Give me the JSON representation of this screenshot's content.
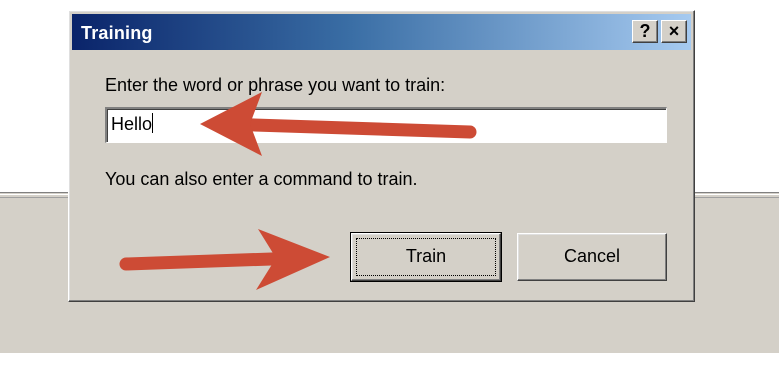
{
  "dialog": {
    "title": "Training",
    "help_glyph": "?",
    "close_glyph": "×",
    "prompt_label": "Enter the word or phrase you want to train:",
    "input_value": "Hello",
    "info_label": "You can also enter a command to train.",
    "train_label": "Train",
    "cancel_label": "Cancel"
  },
  "annotations": {
    "arrow_color": "#cd4b35"
  },
  "colors": {
    "dialog_face": "#d4d0c8",
    "title_start": "#0a246a",
    "title_end": "#a6caf0"
  }
}
